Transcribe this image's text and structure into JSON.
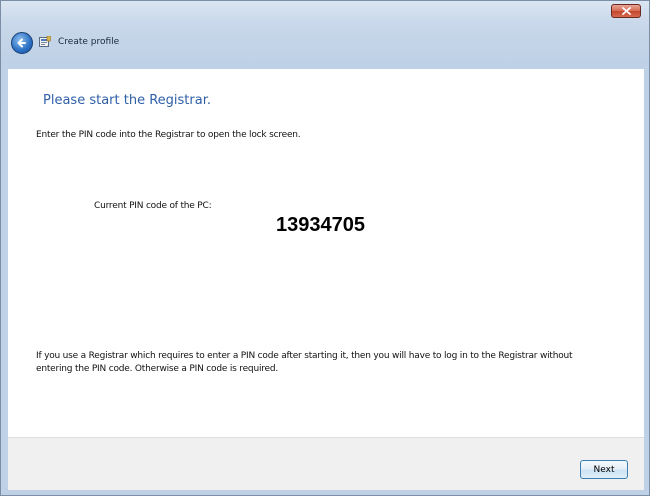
{
  "window": {
    "close_icon": "close-icon"
  },
  "nav": {
    "back_icon": "back-arrow-icon",
    "profile_icon": "profile-icon",
    "title": "Create profile"
  },
  "main": {
    "heading": "Please start the Registrar.",
    "instruction": "Enter the PIN code into the Registrar to open the lock screen.",
    "pin_label": "Current PIN code of the PC:",
    "pin_code": "13934705",
    "note": "If you use a Registrar which requires to enter a PIN code after starting it, then you will have to log in to the Registrar without entering the PIN code. Otherwise a PIN code is required."
  },
  "footer": {
    "next_label": "Next"
  },
  "colors": {
    "heading": "#2f5fa7",
    "footer_bg": "#f0f0f0",
    "close_red": "#c2462d"
  }
}
